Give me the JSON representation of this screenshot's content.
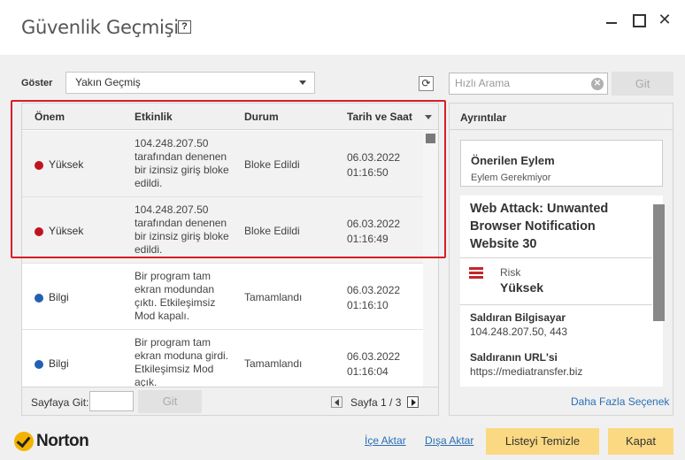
{
  "window": {
    "title": "Güvenlik Geçmişi",
    "help_glyph": "?",
    "close_glyph": "✕"
  },
  "filter": {
    "label": "Göster",
    "selected": "Yakın Geçmiş"
  },
  "search": {
    "placeholder": "Hızlı Arama",
    "go_label": "Git"
  },
  "table": {
    "columns": [
      "Önem",
      "Etkinlik",
      "Durum",
      "Tarih ve Saat"
    ],
    "rows": [
      {
        "severity": "Yüksek",
        "severity_color": "#c1121f",
        "activity": "104.248.207.50 tarafından denenen bir izinsiz giriş bloke edildi.",
        "status": "Bloke Edildi",
        "date": "06.03.2022",
        "time": "01:16:50"
      },
      {
        "severity": "Yüksek",
        "severity_color": "#c1121f",
        "activity": "104.248.207.50 tarafından denenen bir izinsiz giriş bloke edildi.",
        "status": "Bloke Edildi",
        "date": "06.03.2022",
        "time": "01:16:49"
      },
      {
        "severity": "Bilgi",
        "severity_color": "#2260b3",
        "activity": "Bir program tam ekran modundan çıktı. Etkileşimsiz Mod kapalı.",
        "status": "Tamamlandı",
        "date": "06.03.2022",
        "time": "01:16:10"
      },
      {
        "severity": "Bilgi",
        "severity_color": "#2260b3",
        "activity": "Bir program tam ekran moduna girdi. Etkileşimsiz Mod açık.",
        "status": "Tamamlandı",
        "date": "06.03.2022",
        "time": "01:16:04"
      }
    ]
  },
  "pagination": {
    "goto_label": "Sayfaya Git:",
    "goto_button": "Git",
    "page_text": "Sayfa 1 / 3"
  },
  "details": {
    "header": "Ayrıntılar",
    "recommended_title": "Önerilen Eylem",
    "recommended_value": "Eylem Gerekmiyor",
    "attack_title": "Web Attack: Unwanted Browser Notification Website 30",
    "risk_label": "Risk",
    "risk_value": "Yüksek",
    "attacker_label": "Saldıran Bilgisayar",
    "attacker_value": "104.248.207.50, 443",
    "url_label": "Saldıranın URL'si",
    "url_value": "https://mediatransfer.biz",
    "more_options": "Daha Fazla Seçenek"
  },
  "footer": {
    "brand": "Norton",
    "import_label": "İçe Aktar",
    "export_label": "Dışa Aktar",
    "clear_label": "Listeyi Temizle",
    "close_label": "Kapat"
  }
}
